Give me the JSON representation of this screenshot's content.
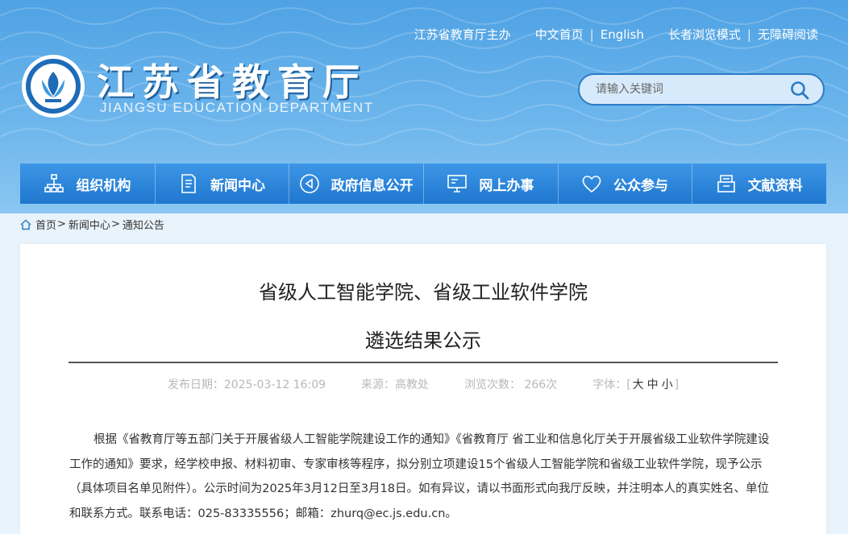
{
  "top_links": {
    "sponsor": "江苏省教育厅主办",
    "home_cn": "中文首页",
    "english": "English",
    "elder_mode": "长者浏览模式",
    "accessible": "无障碍阅读"
  },
  "header": {
    "title": "江苏省教育厅",
    "subtitle": "JIANGSU EDUCATION DEPARTMENT"
  },
  "search": {
    "placeholder": "请输入关键词"
  },
  "nav": [
    {
      "label": "组织机构",
      "icon": "org-chart-icon"
    },
    {
      "label": "新闻中心",
      "icon": "document-icon"
    },
    {
      "label": "政府信息公开",
      "icon": "megaphone-icon"
    },
    {
      "label": "网上办事",
      "icon": "monitor-icon"
    },
    {
      "label": "公众参与",
      "icon": "heart-icon"
    },
    {
      "label": "文献资料",
      "icon": "archive-icon"
    }
  ],
  "breadcrumb": {
    "home": "首页",
    "news": "新闻中心",
    "notices": "通知公告"
  },
  "article": {
    "title_line1": "省级人工智能学院、省级工业软件学院",
    "title_line2": "遴选结果公示",
    "publish_date": "发布日期：2025-03-12 16:09",
    "source": "来源：高教处",
    "views": "浏览次数： 266次",
    "font_label": "字体：",
    "font_large": "大",
    "font_medium": "中",
    "font_small": "小",
    "body": "根据《省教育厅等五部门关于开展省级人工智能学院建设工作的通知》《省教育厅 省工业和信息化厅关于开展省级工业软件学院建设工作的通知》要求，经学校申报、材料初审、专家审核等程序，拟分别立项建设15个省级人工智能学院和省级工业软件学院，现予公示（具体项目名单见附件）。公示时间为2025年3月12日至3月18日。如有异议，请以书面形式向我厅反映，并注明本人的真实姓名、单位和联系方式。联系电话：025-83335556；邮箱：zhurq@ec.js.edu.cn。"
  },
  "colors": {
    "header_top": "#4fa2e4",
    "nav": "#1f77cf",
    "page_bg": "#e9f3fb"
  }
}
